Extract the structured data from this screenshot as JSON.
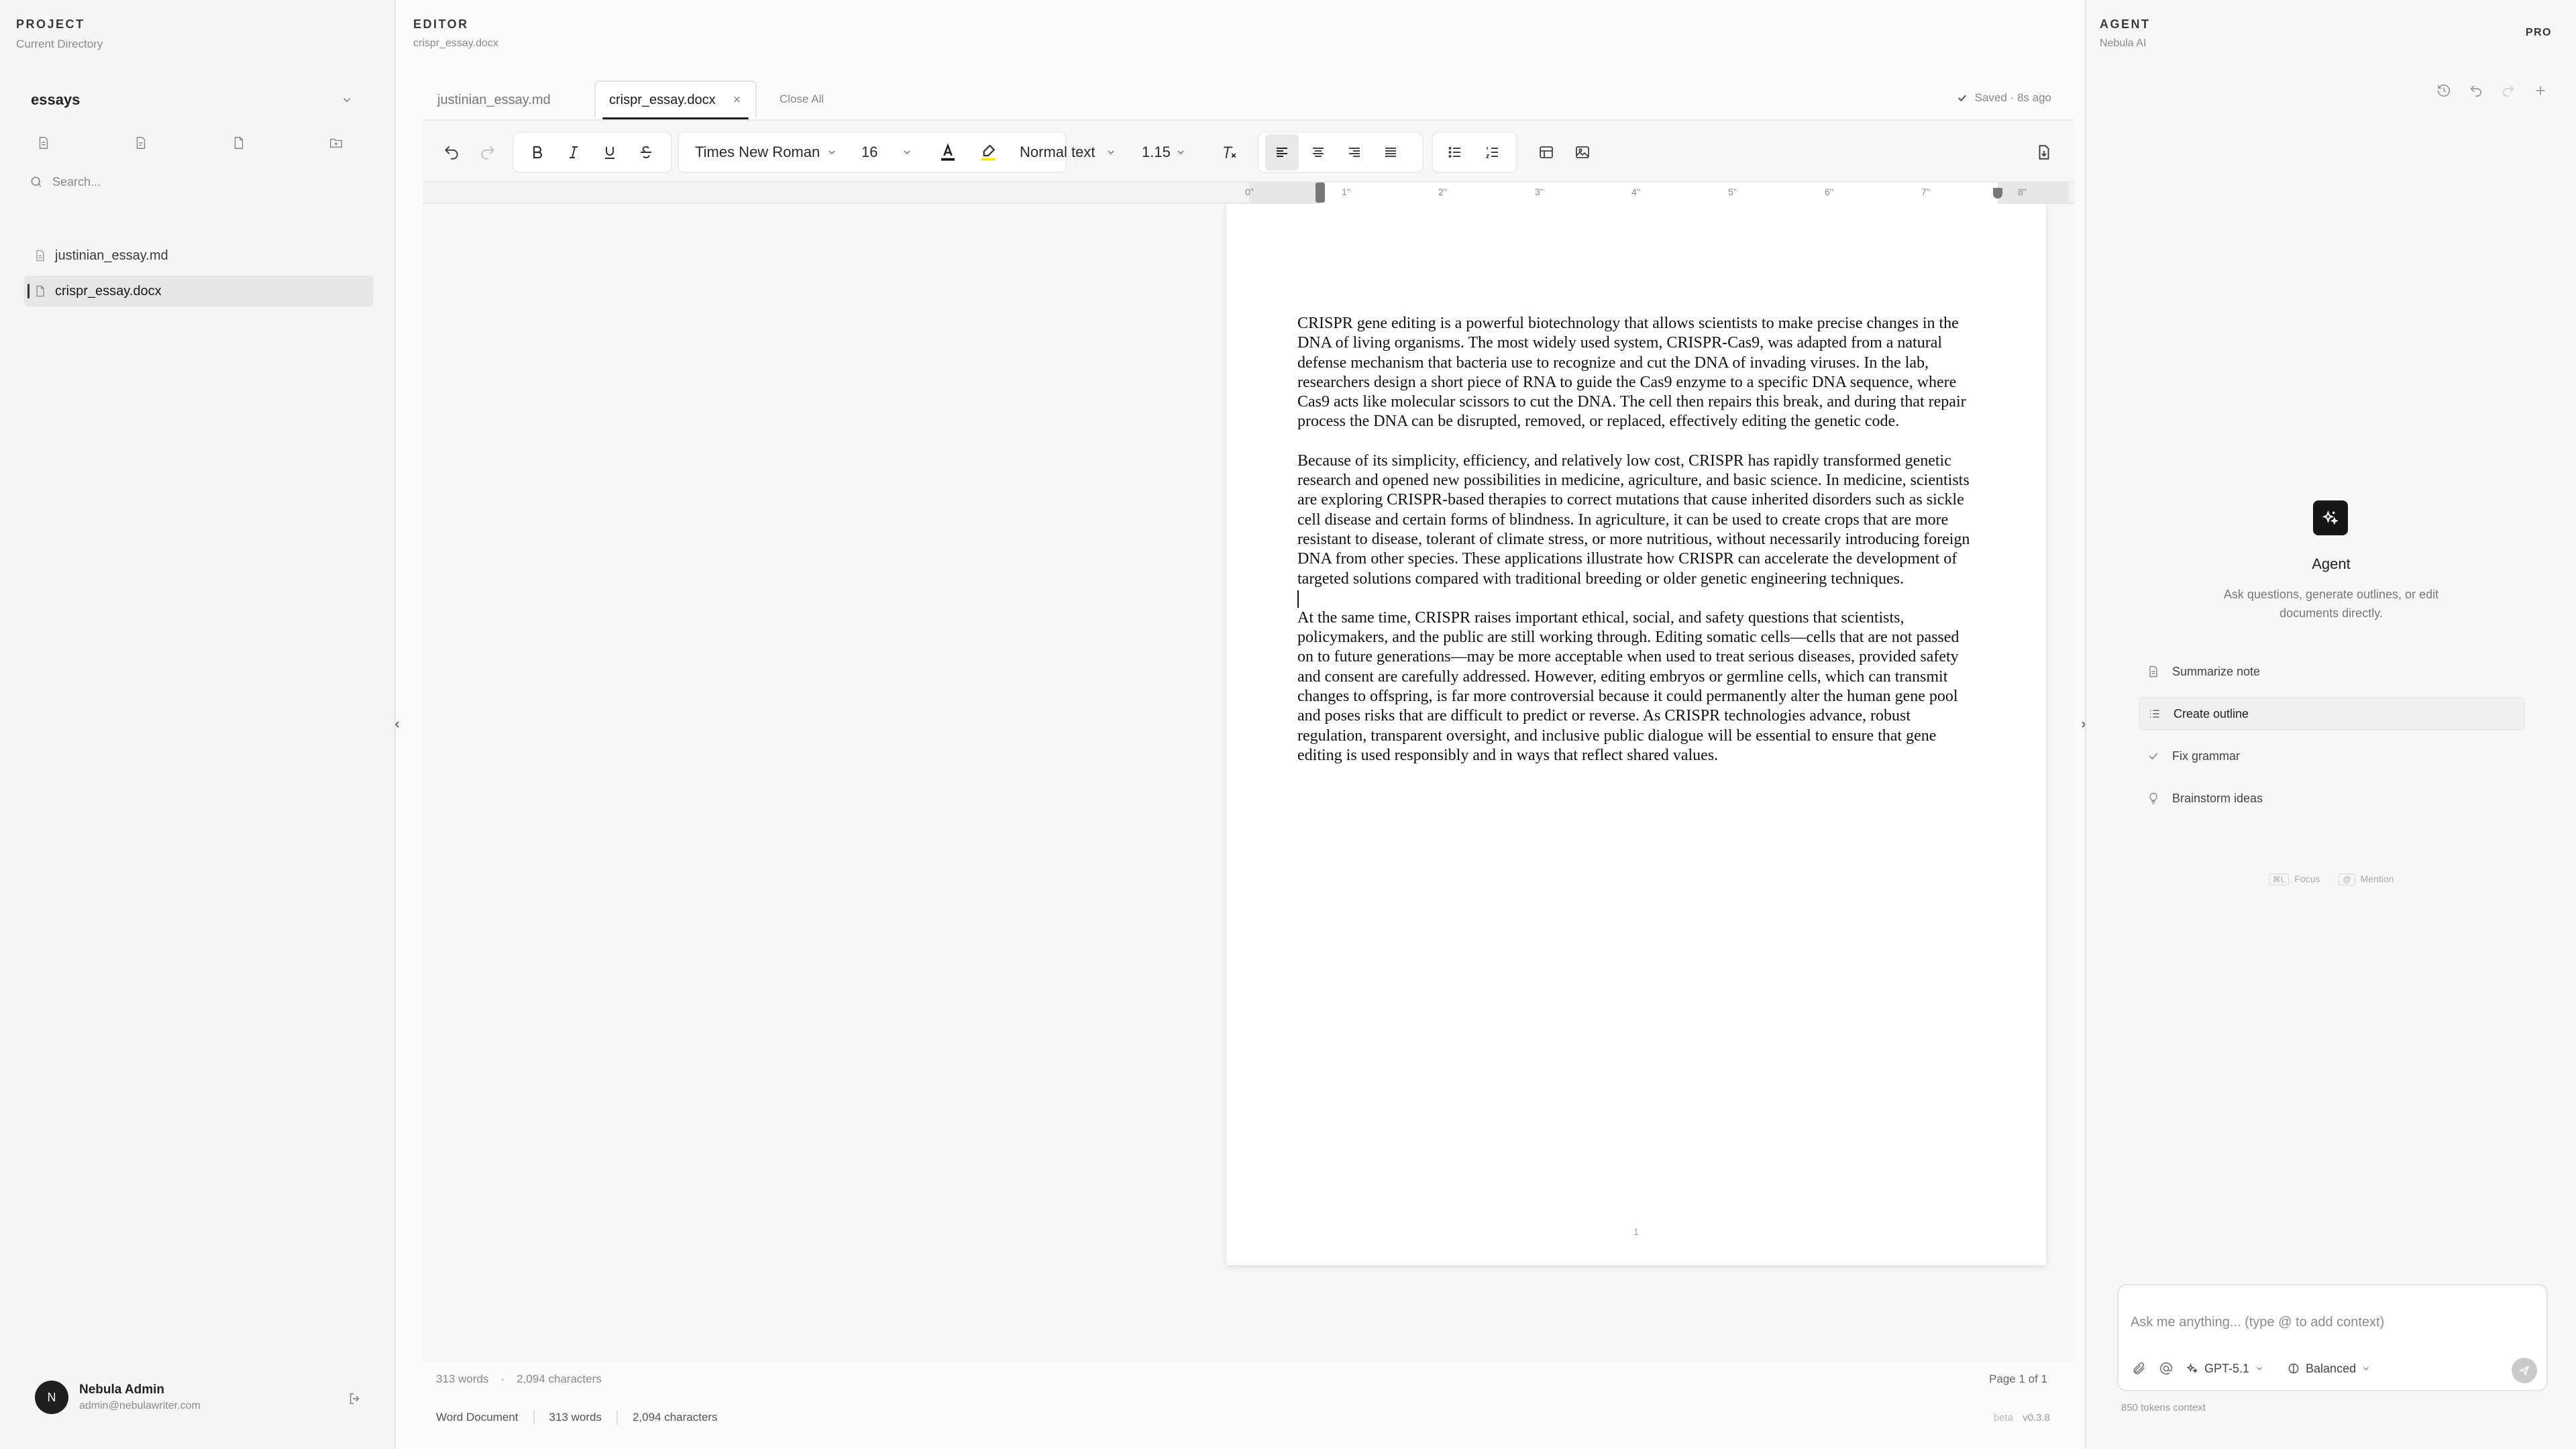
{
  "project": {
    "section_title": "PROJECT",
    "section_subtitle": "Current Directory",
    "folder_name": "essays",
    "search_placeholder": "Search...",
    "files": [
      {
        "name": "justinian_essay.md"
      },
      {
        "name": "crispr_essay.docx"
      }
    ],
    "user": {
      "initial": "N",
      "name": "Nebula Admin",
      "email": "admin@nebulawriter.com"
    }
  },
  "editor": {
    "section_title": "EDITOR",
    "section_subtitle": "crispr_essay.docx",
    "tabs": [
      {
        "label": "justinian_essay.md"
      },
      {
        "label": "crispr_essay.docx",
        "close": "×"
      }
    ],
    "close_all": "Close All",
    "saved_status": "Saved · 8s ago",
    "toolbar": {
      "font_family": "Times New Roman",
      "font_size": "16",
      "style": "Normal text",
      "line_spacing": "1.15",
      "highlight_color": "#f5e700",
      "text_color": "#111111"
    },
    "ruler": {
      "marks": [
        "0\"",
        "1\"",
        "2\"",
        "3\"",
        "4\"",
        "5\"",
        "6\"",
        "7\"",
        "8\""
      ]
    },
    "document": {
      "paragraphs": [
        "CRISPR gene editing is a powerful biotechnology that allows scientists to make precise changes in the DNA of living organisms. The most widely used system, CRISPR-Cas9, was adapted from a natural defense mechanism that bacteria use to recognize and cut the DNA of invading viruses. In the lab, researchers design a short piece of RNA to guide the Cas9 enzyme to a specific DNA sequence, where Cas9 acts like molecular scissors to cut the DNA. The cell then repairs this break, and during that repair process the DNA can be disrupted, removed, or replaced, effectively editing the genetic code.",
        "Because of its simplicity, efficiency, and relatively low cost, CRISPR has rapidly transformed genetic research and opened new possibilities in medicine, agriculture, and basic science. In medicine, scientists are exploring CRISPR-based therapies to correct mutations that cause inherited disorders such as sickle cell disease and certain forms of blindness. In agriculture, it can be used to create crops that are more resistant to disease, tolerant of climate stress, or more nutritious, without necessarily introducing foreign  DNA from other species. These applications illustrate how CRISPR can accelerate the development of targeted solutions compared with traditional breeding or older genetic engineering techniques.",
        "At the same time, CRISPR raises important ethical, social, and safety questions that scientists, policymakers, and the public are still working through. Editing somatic cells—cells that are not passed on to future generations—may be more acceptable when used to treat serious diseases, provided safety and consent are carefully addressed. However, editing embryos or germline cells, which can transmit changes to offspring, is far more controversial because it could permanently alter the human gene pool and poses risks that are difficult to predict or reverse. As CRISPR technologies advance, robust regulation, transparent oversight, and inclusive public dialogue will be essential to ensure that gene editing is used responsibly and in ways that reflect shared values."
      ],
      "page_number": "1"
    },
    "status": {
      "words": "313 words",
      "characters": "2,094 characters",
      "page": "Page 1 of 1",
      "doc_type": "Word Document",
      "version_tag": "beta",
      "version": "v0.3.8"
    }
  },
  "agent": {
    "section_title": "AGENT",
    "section_subtitle": "Nebula AI",
    "plan_badge": "PRO",
    "heading": "Agent",
    "description": "Ask questions, generate outlines, or edit documents directly.",
    "suggestions": [
      {
        "label": "Summarize note",
        "icon": "note-icon"
      },
      {
        "label": "Create outline",
        "icon": "list-icon"
      },
      {
        "label": "Fix grammar",
        "icon": "check-icon"
      },
      {
        "label": "Brainstorm ideas",
        "icon": "lightbulb-icon"
      }
    ],
    "hints": [
      {
        "key": "⌘L",
        "label": "Focus"
      },
      {
        "key": "@",
        "label": "Mention"
      }
    ],
    "input_placeholder": "Ask me anything... (type @ to add context)",
    "model": "GPT-5.1",
    "mode": "Balanced",
    "tokens": "850 tokens context"
  }
}
